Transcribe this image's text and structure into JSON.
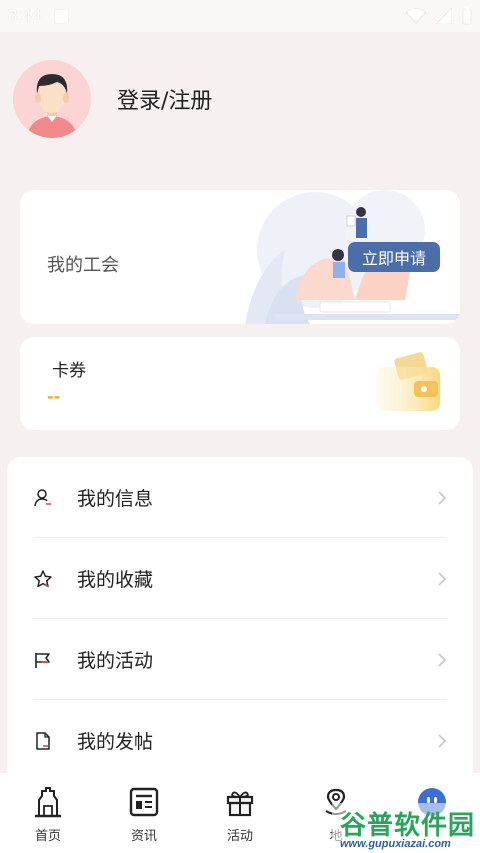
{
  "status_bar": {
    "time": "3:44"
  },
  "profile": {
    "login_label": "登录/注册"
  },
  "union_card": {
    "label": "我的工会",
    "apply_button": "立即申请"
  },
  "coupon_card": {
    "title": "卡券",
    "value": "--"
  },
  "menu": {
    "items": [
      {
        "label": "我的信息",
        "icon": "user-icon"
      },
      {
        "label": "我的收藏",
        "icon": "star-icon"
      },
      {
        "label": "我的活动",
        "icon": "flag-icon"
      },
      {
        "label": "我的发帖",
        "icon": "document-icon"
      }
    ]
  },
  "tabbar": {
    "tabs": [
      {
        "label": "首页",
        "icon": "home-monument-icon"
      },
      {
        "label": "资讯",
        "icon": "news-icon"
      },
      {
        "label": "活动",
        "icon": "gift-icon"
      },
      {
        "label": "地",
        "icon": "map-pin-icon"
      },
      {
        "label": "",
        "icon": "profile-face-icon"
      }
    ]
  },
  "watermark": {
    "brand": "谷普软件园",
    "url": "www.gupuxiazai.com"
  },
  "colors": {
    "accent": "#4c6ea8",
    "coupon_value": "#f5a623",
    "background": "#f6f0f0"
  }
}
